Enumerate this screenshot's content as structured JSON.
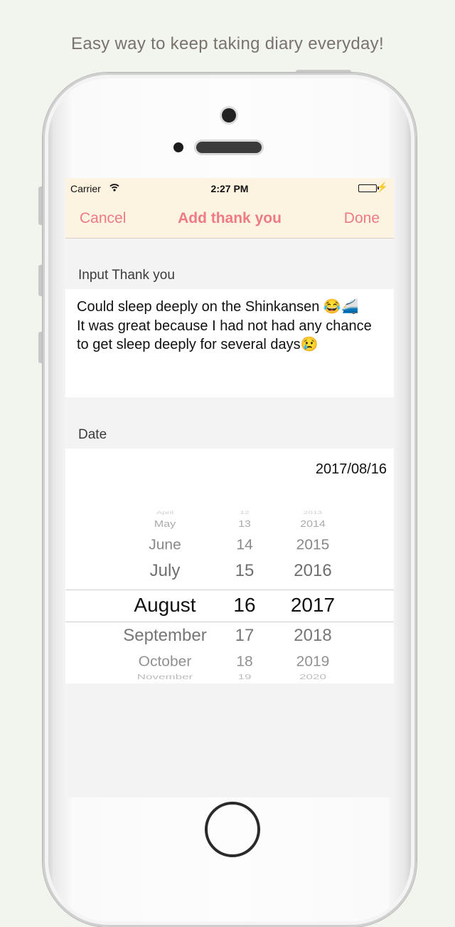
{
  "tagline": "Easy way to keep taking diary everyday!",
  "status": {
    "carrier": "Carrier",
    "time": "2:27 PM"
  },
  "nav": {
    "cancel": "Cancel",
    "title": "Add thank you",
    "done": "Done"
  },
  "input_section": {
    "label": "Input Thank you",
    "text": "Could sleep deeply on the Shinkansen 😂🚄\nIt was great because I had not had any chance to get sleep deeply for several days😢"
  },
  "date_section": {
    "label": "Date",
    "value": "2017/08/16"
  },
  "picker": {
    "months": [
      "April",
      "May",
      "June",
      "July",
      "August",
      "September",
      "October",
      "November"
    ],
    "days": [
      "12",
      "13",
      "14",
      "15",
      "16",
      "17",
      "18",
      "19"
    ],
    "years": [
      "2013",
      "2014",
      "2015",
      "2016",
      "2017",
      "2018",
      "2019",
      "2020"
    ],
    "selected": {
      "month": "August",
      "day": "16",
      "year": "2017"
    }
  },
  "colors": {
    "accent": "#ee7a83",
    "navbar_bg": "#fdf3e1",
    "page_bg": "#f1f5ee",
    "tagline": "#7a736b"
  }
}
